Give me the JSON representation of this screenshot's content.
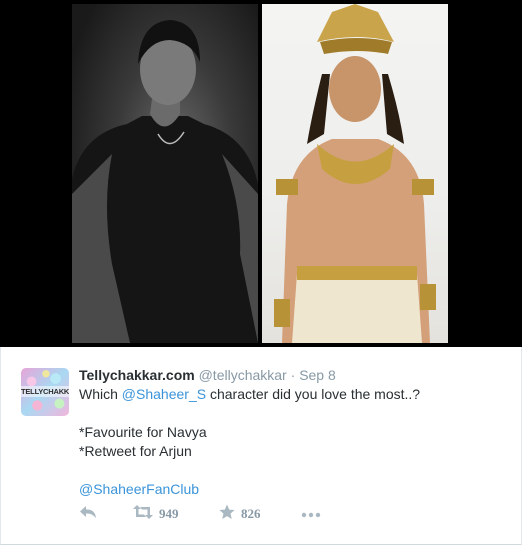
{
  "tweet": {
    "display_name": "Tellychakkar.com",
    "handle": "@tellychakkar",
    "separator": "·",
    "date": "Sep 8",
    "avatar_text": "TELLYCHAKKAR",
    "line1_prefix": "Which ",
    "line1_mention": "@Shaheer_S",
    "line1_suffix": " character did you love the most..?",
    "line2": "*Favourite for Navya",
    "line3": "*Retweet for Arjun",
    "hashtag_mention": "@ShaheerFanClub"
  },
  "actions": {
    "reply_icon": "reply-icon",
    "retweet_icon": "retweet-icon",
    "retweet_count": "949",
    "favorite_icon": "star-icon",
    "favorite_count": "826",
    "more_icon": "more-icon"
  },
  "colors": {
    "link": "#3b94d9",
    "text": "#292f33",
    "muted": "#8899a6"
  }
}
